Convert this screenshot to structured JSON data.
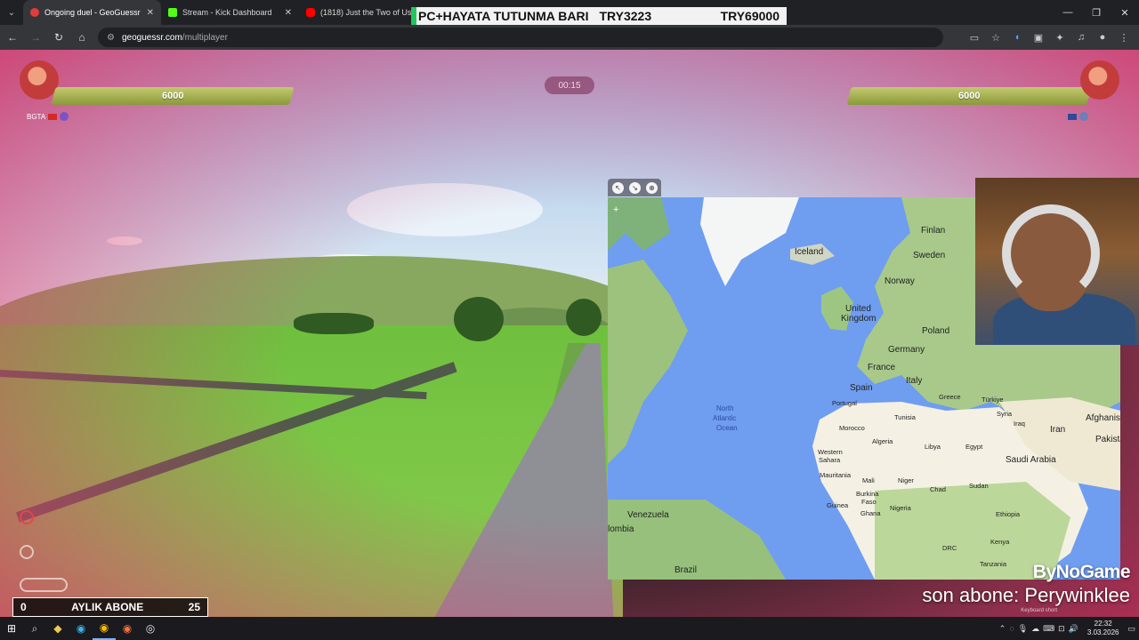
{
  "browser": {
    "tabs": [
      {
        "title": "Ongoing duel - GeoGuessr",
        "favicon_color": "#e23b3b",
        "active": true
      },
      {
        "title": "Stream - Kick Dashboard",
        "favicon_color": "#53fc18",
        "active": false
      },
      {
        "title": "(1818) Just the Two of Us (",
        "favicon_color": "#ff0000",
        "active": false
      }
    ],
    "url_host": "geoguessr.com",
    "url_path": "/multiplayer",
    "window_controls": [
      "minimize",
      "restore",
      "close"
    ]
  },
  "ticker": {
    "text_left": "PC+HAYATA TUTUNMA BARI",
    "text_mid": "TRY3223",
    "text_right": "TRY69000"
  },
  "hud": {
    "player1": {
      "health": "6000",
      "name": "BGTA"
    },
    "player2": {
      "health": "6000"
    },
    "timer": "00:15"
  },
  "map": {
    "labels": {
      "iceland": "Iceland",
      "finland": "Finlan",
      "sweden": "Sweden",
      "norway": "Norway",
      "uk_line1": "United",
      "uk_line2": "Kingdom",
      "poland": "Poland",
      "germany": "Germany",
      "france": "France",
      "italy": "Italy",
      "spain": "Spain",
      "portugal": "Portugal",
      "greece": "Greece",
      "turkiye": "Türkiye",
      "syria": "Syria",
      "iraq": "Iraq",
      "iran": "Iran",
      "afghanistan": "Afghanis",
      "pakistan": "Pakista",
      "tunisia": "Tunisia",
      "morocco": "Morocco",
      "algeria": "Algeria",
      "libya": "Libya",
      "egypt": "Egypt",
      "saudi_arabia": "Saudi Arabia",
      "western_sahara_1": "Western",
      "western_sahara_2": "Sahara",
      "mauritania": "Mauritania",
      "mali": "Mali",
      "niger": "Niger",
      "chad": "Chad",
      "sudan": "Sudan",
      "burkina_1": "Burkina",
      "burkina_2": "Faso",
      "guinea": "Guinea",
      "ghana": "Ghana",
      "nigeria": "Nigeria",
      "ethiopia": "Ethiopia",
      "kenya": "Kenya",
      "tanzania": "Tanzania",
      "drc": "DRC",
      "venezuela": "Venezuela",
      "colombia": "lombia",
      "brazil": "Brazil",
      "atlantic_1": "North",
      "atlantic_2": "Atlantic",
      "atlantic_3": "Ocean"
    }
  },
  "overlays": {
    "sub_goal": {
      "current": "0",
      "label": "AYLIK ABONE",
      "target": "25"
    },
    "brand": "ByNoGame",
    "last_sub": "son abone: Perywinklee",
    "keyboard_hint": "Keyboard short"
  },
  "taskbar": {
    "time": "22:32",
    "date": "3.03.2026"
  }
}
